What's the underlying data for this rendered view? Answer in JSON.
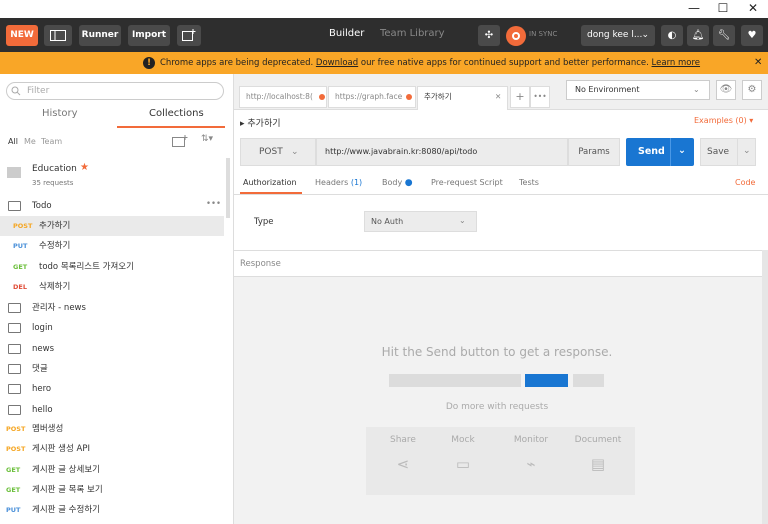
{
  "window": {
    "minimize": "—",
    "maximize": "☐",
    "close": "✕"
  },
  "header": {
    "new_label": "NEW",
    "runner_label": "Runner",
    "import_label": "Import",
    "builder_tab": "Builder",
    "team_library_tab": "Team Library",
    "sync_status": "IN SYNC",
    "user_name": "dong kee l..."
  },
  "banner": {
    "text_before": "Chrome apps are being deprecated.",
    "download_link": "Download",
    "text_after": "our free native apps for continued support and better performance.",
    "learn_more": "Learn more"
  },
  "sidebar": {
    "search_placeholder": "Filter",
    "tab_history": "History",
    "tab_collections": "Collections",
    "filter_all": "All",
    "filter_me": "Me",
    "filter_team": "Team",
    "collection": {
      "name": "Education",
      "count": "35 requests"
    },
    "folder_todo": "Todo",
    "todo_requests": [
      {
        "method": "POST",
        "name": "추가하기"
      },
      {
        "method": "PUT",
        "name": "수정하기"
      },
      {
        "method": "GET",
        "name": "todo 목록리스트 가져오기"
      },
      {
        "method": "DEL",
        "name": "삭제하기"
      }
    ],
    "folders": [
      "관리자 - news",
      "login",
      "news",
      "댓글",
      "hero",
      "hello"
    ],
    "loose_requests": [
      {
        "method": "POST",
        "name": "멤버생성"
      },
      {
        "method": "POST",
        "name": "게시판 생성 API"
      },
      {
        "method": "GET",
        "name": "게시판 글 상세보기"
      },
      {
        "method": "GET",
        "name": "게시판 글 목록 보기"
      },
      {
        "method": "PUT",
        "name": "게시판 글 수정하기"
      }
    ]
  },
  "tabs": [
    {
      "label": "http://localhost:8("
    },
    {
      "label": "https://graph.face"
    },
    {
      "label": "추가하기"
    }
  ],
  "tab_add": "+",
  "tab_more": "•••",
  "environment": "No Environment",
  "request": {
    "name": "추가하기",
    "examples": "Examples (0) ▾",
    "method": "POST",
    "url": "http://www.javabrain.kr:8080/api/todo",
    "params": "Params",
    "send": "Send",
    "save": "Save"
  },
  "subtabs": {
    "authorization": "Authorization",
    "headers": "Headers",
    "headers_count": "(1)",
    "body": "Body",
    "prerequest": "Pre-request Script",
    "tests": "Tests",
    "code": "Code"
  },
  "auth": {
    "type_label": "Type",
    "type_value": "No Auth"
  },
  "response": {
    "label": "Response",
    "hint": "Hit the Send button to get a response.",
    "more": "Do more with requests",
    "cards": [
      "Share",
      "Mock",
      "Monitor",
      "Document"
    ]
  }
}
